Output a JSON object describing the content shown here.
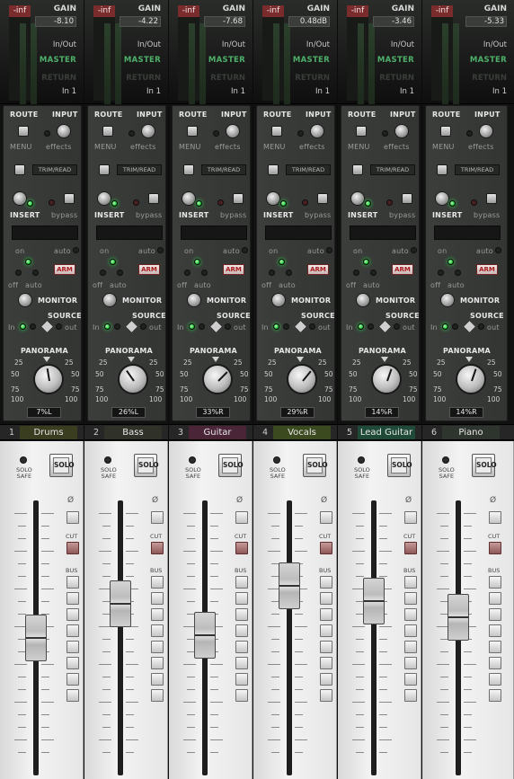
{
  "labels": {
    "meter_value": "-inf",
    "gain": "GAIN",
    "in_out": "In/Out",
    "master": "MASTER",
    "return": "RETURN",
    "input_source": "In 1",
    "route": "ROUTE",
    "input": "INPUT",
    "menu": "MENU",
    "effects": "effects",
    "trim_read": "TRIM/READ",
    "insert": "INSERT",
    "bypass": "bypass",
    "on": "on",
    "auto": "auto",
    "off": "off",
    "arm": "ARM",
    "monitor": "MONITOR",
    "source": "SOURCE",
    "in": "In",
    "out": "out",
    "panorama": "PANORAMA",
    "pan_25": "25",
    "pan_50": "50",
    "pan_75": "75",
    "pan_100": "100",
    "solo_safe_1": "SOLO",
    "solo_safe_2": "SAFE",
    "solo": "SOLO",
    "phase": "Ø",
    "cut": "CUT",
    "bus": "BUS"
  },
  "colors": {
    "master_green": "#4fb06a",
    "meter_red": "#7a2b2b",
    "led_green": "#22c33a",
    "arm_red": "#a81d1d",
    "cut_red": "#8f5858"
  },
  "channels": [
    {
      "number": "1",
      "name": "Drums",
      "gain": "-8.10",
      "pan": "7%L",
      "pan_value": -7,
      "fader_level": 0.5,
      "name_color": "#3a3d1f"
    },
    {
      "number": "2",
      "name": "Bass",
      "gain": "-4.22",
      "pan": "26%L",
      "pan_value": -26,
      "fader_level": 0.65,
      "name_color": "#303229"
    },
    {
      "number": "3",
      "name": "Guitar",
      "gain": "-7.68",
      "pan": "33%R",
      "pan_value": 33,
      "fader_level": 0.51,
      "name_color": "#4a2538"
    },
    {
      "number": "4",
      "name": "Vocals",
      "gain": "0.48dB",
      "pan": "29%R",
      "pan_value": 29,
      "fader_level": 0.73,
      "name_color": "#3b4a1f"
    },
    {
      "number": "5",
      "name": "Lead Guitar",
      "gain": "-3.46",
      "pan": "14%R",
      "pan_value": 14,
      "fader_level": 0.66,
      "name_color": "#1f4a38"
    },
    {
      "number": "6",
      "name": "Piano",
      "gain": "-5.33",
      "pan": "14%R",
      "pan_value": 14,
      "fader_level": 0.59,
      "name_color": "#2e342e"
    }
  ]
}
